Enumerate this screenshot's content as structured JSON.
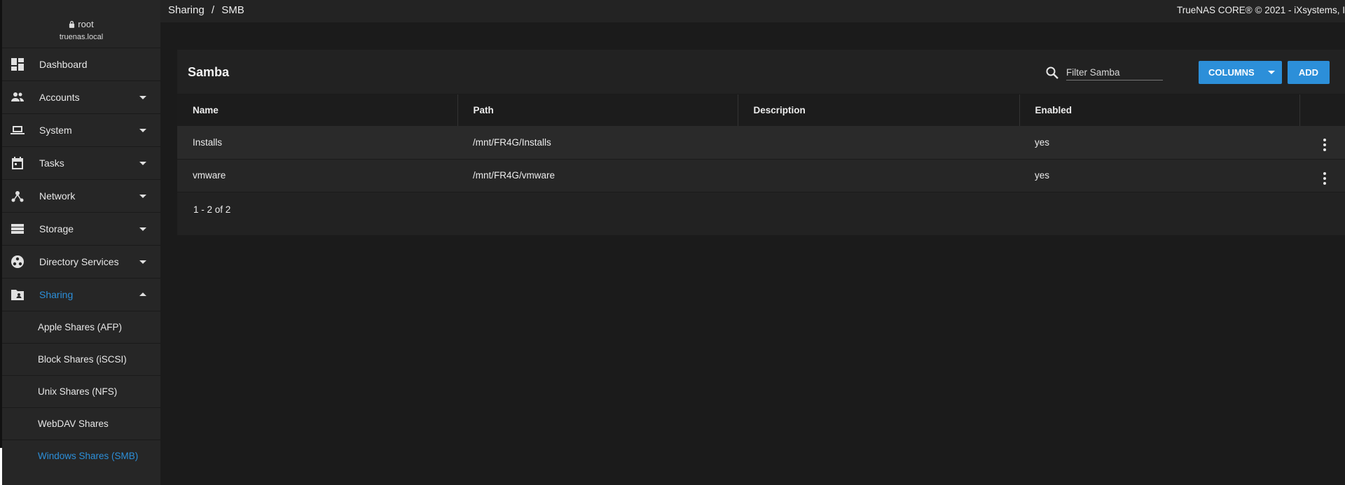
{
  "user": {
    "name": "root",
    "host": "truenas.local"
  },
  "sidebar": {
    "items": [
      {
        "label": "Dashboard",
        "icon": "dashboard-icon"
      },
      {
        "label": "Accounts",
        "icon": "people-icon"
      },
      {
        "label": "System",
        "icon": "laptop-icon"
      },
      {
        "label": "Tasks",
        "icon": "calendar-icon"
      },
      {
        "label": "Network",
        "icon": "network-icon"
      },
      {
        "label": "Storage",
        "icon": "storage-icon"
      },
      {
        "label": "Directory Services",
        "icon": "directory-icon"
      },
      {
        "label": "Sharing",
        "icon": "shared-folder-icon"
      }
    ],
    "sharing_sub": [
      {
        "label": "Apple Shares (AFP)"
      },
      {
        "label": "Block Shares (iSCSI)"
      },
      {
        "label": "Unix Shares (NFS)"
      },
      {
        "label": "WebDAV Shares"
      },
      {
        "label": "Windows Shares (SMB)"
      }
    ]
  },
  "header": {
    "breadcrumb": [
      "Sharing",
      "/",
      "SMB"
    ],
    "copyright": "TrueNAS CORE® © 2021 - iXsystems, I"
  },
  "card": {
    "title": "Samba",
    "search_placeholder": "Filter Samba",
    "columns_label": "COLUMNS",
    "add_label": "ADD",
    "columns": [
      "Name",
      "Path",
      "Description",
      "Enabled"
    ],
    "rows": [
      {
        "name": "Installs",
        "path": "/mnt/FR4G/Installs",
        "description": "",
        "enabled": "yes"
      },
      {
        "name": "vmware",
        "path": "/mnt/FR4G/vmware",
        "description": "",
        "enabled": "yes"
      }
    ],
    "pager": "1 - 2 of 2"
  },
  "colors": {
    "accent": "#2c8fd9",
    "sidebar": "#262626",
    "background": "#1b1b1b"
  }
}
